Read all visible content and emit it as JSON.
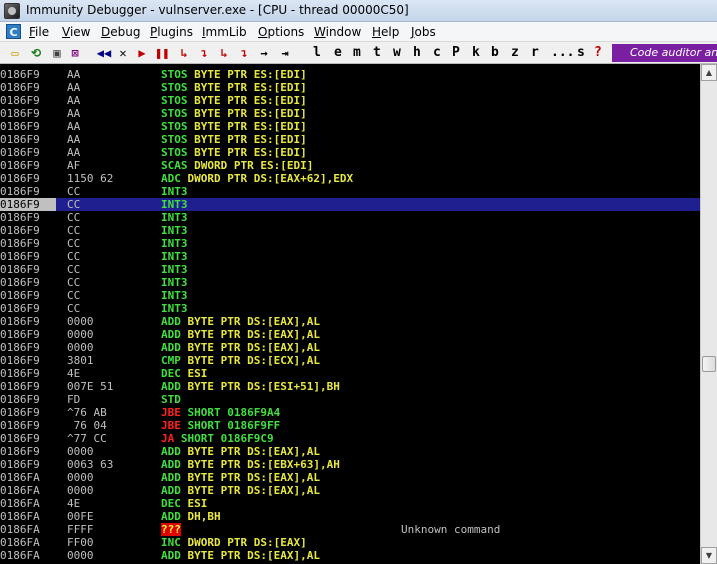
{
  "window": {
    "title": "Immunity Debugger - vulnserver.exe - [CPU - thread 00000C50]"
  },
  "menubar": {
    "cpu_icon": "C",
    "items": [
      {
        "accel": "F",
        "rest": "ile"
      },
      {
        "accel": "V",
        "rest": "iew"
      },
      {
        "accel": "D",
        "rest": "ebug"
      },
      {
        "accel": "P",
        "rest": "lugins"
      },
      {
        "accel": "I",
        "rest": "mmLib"
      },
      {
        "accel": "O",
        "rest": "ptions"
      },
      {
        "accel": "W",
        "rest": "indow"
      },
      {
        "accel": "H",
        "rest": "elp"
      },
      {
        "accel": "J",
        "rest": "obs"
      }
    ]
  },
  "toolbar": {
    "icons": [
      {
        "name": "open-icon",
        "glyph": "▭",
        "color": "#c8a000"
      },
      {
        "name": "restart-icon",
        "glyph": "⟲",
        "color": "#208020"
      },
      {
        "name": "close-file-icon",
        "glyph": "▣",
        "color": "#404040"
      },
      {
        "name": "debug-options-icon",
        "glyph": "⊠",
        "color": "#800080"
      },
      {
        "name": "rewind-icon",
        "glyph": "◀◀",
        "color": "#000080"
      },
      {
        "name": "stop-icon",
        "glyph": "✕",
        "color": "#000000"
      },
      {
        "name": "run-icon",
        "glyph": "▶",
        "color": "#c00000"
      },
      {
        "name": "pause-icon",
        "glyph": "❚❚",
        "color": "#c00000"
      },
      {
        "name": "step-into-icon",
        "glyph": "↳",
        "color": "#c00000"
      },
      {
        "name": "step-over-icon",
        "glyph": "↴",
        "color": "#c00000"
      },
      {
        "name": "trace-into-icon",
        "glyph": "↳",
        "color": "#c00000"
      },
      {
        "name": "trace-over-icon",
        "glyph": "↴",
        "color": "#c00000"
      },
      {
        "name": "execute-till-return-icon",
        "glyph": "→",
        "color": "#000000"
      },
      {
        "name": "go-to-icon",
        "glyph": "⇥",
        "color": "#000000"
      }
    ],
    "letters": [
      "l",
      "e",
      "m",
      "t",
      "w",
      "h",
      "c",
      "P",
      "k",
      "b",
      "z",
      "r",
      "...",
      "s",
      "?"
    ],
    "plugin_banner": "Code auditor and"
  },
  "disassembly": {
    "rows": [
      {
        "addr": "0186F9",
        "hex": "AA",
        "mnem": "STOS",
        "ops": "BYTE PTR ES:[EDI]",
        "kind": "normal"
      },
      {
        "addr": "0186F9",
        "hex": "AA",
        "mnem": "STOS",
        "ops": "BYTE PTR ES:[EDI]",
        "kind": "normal"
      },
      {
        "addr": "0186F9",
        "hex": "AA",
        "mnem": "STOS",
        "ops": "BYTE PTR ES:[EDI]",
        "kind": "normal"
      },
      {
        "addr": "0186F9",
        "hex": "AA",
        "mnem": "STOS",
        "ops": "BYTE PTR ES:[EDI]",
        "kind": "normal"
      },
      {
        "addr": "0186F9",
        "hex": "AA",
        "mnem": "STOS",
        "ops": "BYTE PTR ES:[EDI]",
        "kind": "normal"
      },
      {
        "addr": "0186F9",
        "hex": "AA",
        "mnem": "STOS",
        "ops": "BYTE PTR ES:[EDI]",
        "kind": "normal"
      },
      {
        "addr": "0186F9",
        "hex": "AA",
        "mnem": "STOS",
        "ops": "BYTE PTR ES:[EDI]",
        "kind": "normal"
      },
      {
        "addr": "0186F9",
        "hex": "AF",
        "mnem": "SCAS",
        "ops": "DWORD PTR ES:[EDI]",
        "kind": "normal"
      },
      {
        "addr": "0186F9",
        "hex": "1150 62",
        "mnem": "ADC",
        "ops": "DWORD PTR DS:[EAX+62],EDX",
        "kind": "normal"
      },
      {
        "addr": "0186F9",
        "hex": "CC",
        "mnem": "INT3",
        "ops": "",
        "kind": "normal"
      },
      {
        "addr": "0186F9",
        "hex": "CC",
        "mnem": "INT3",
        "ops": "",
        "kind": "normal",
        "selected": true
      },
      {
        "addr": "0186F9",
        "hex": "CC",
        "mnem": "INT3",
        "ops": "",
        "kind": "normal"
      },
      {
        "addr": "0186F9",
        "hex": "CC",
        "mnem": "INT3",
        "ops": "",
        "kind": "normal"
      },
      {
        "addr": "0186F9",
        "hex": "CC",
        "mnem": "INT3",
        "ops": "",
        "kind": "normal"
      },
      {
        "addr": "0186F9",
        "hex": "CC",
        "mnem": "INT3",
        "ops": "",
        "kind": "normal"
      },
      {
        "addr": "0186F9",
        "hex": "CC",
        "mnem": "INT3",
        "ops": "",
        "kind": "normal"
      },
      {
        "addr": "0186F9",
        "hex": "CC",
        "mnem": "INT3",
        "ops": "",
        "kind": "normal"
      },
      {
        "addr": "0186F9",
        "hex": "CC",
        "mnem": "INT3",
        "ops": "",
        "kind": "normal"
      },
      {
        "addr": "0186F9",
        "hex": "CC",
        "mnem": "INT3",
        "ops": "",
        "kind": "normal"
      },
      {
        "addr": "0186F9",
        "hex": "0000",
        "mnem": "ADD",
        "ops": "BYTE PTR DS:[EAX],AL",
        "kind": "normal"
      },
      {
        "addr": "0186F9",
        "hex": "0000",
        "mnem": "ADD",
        "ops": "BYTE PTR DS:[EAX],AL",
        "kind": "normal"
      },
      {
        "addr": "0186F9",
        "hex": "0000",
        "mnem": "ADD",
        "ops": "BYTE PTR DS:[EAX],AL",
        "kind": "normal"
      },
      {
        "addr": "0186F9",
        "hex": "3801",
        "mnem": "CMP",
        "ops": "BYTE PTR DS:[ECX],AL",
        "kind": "normal"
      },
      {
        "addr": "0186F9",
        "hex": "4E",
        "mnem": "DEC",
        "ops": "ESI",
        "kind": "normal"
      },
      {
        "addr": "0186F9",
        "hex": "007E 51",
        "mnem": "ADD",
        "ops": "BYTE PTR DS:[ESI+51],BH",
        "kind": "normal"
      },
      {
        "addr": "0186F9",
        "hex": "FD",
        "mnem": "STD",
        "ops": "",
        "kind": "normal"
      },
      {
        "addr": "0186F9",
        "hex": "^76 AB",
        "mnem": "JBE",
        "ops": "SHORT 0186F9A4",
        "kind": "jump"
      },
      {
        "addr": "0186F9",
        "hex": " 76 04",
        "mnem": "JBE",
        "ops": "SHORT 0186F9FF",
        "kind": "jump"
      },
      {
        "addr": "0186F9",
        "hex": "^77 CC",
        "mnem": "JA",
        "ops": "SHORT 0186F9C9",
        "kind": "jump"
      },
      {
        "addr": "0186F9",
        "hex": "0000",
        "mnem": "ADD",
        "ops": "BYTE PTR DS:[EAX],AL",
        "kind": "normal"
      },
      {
        "addr": "0186F9",
        "hex": "0063 63",
        "mnem": "ADD",
        "ops": "BYTE PTR DS:[EBX+63],AH",
        "kind": "normal"
      },
      {
        "addr": "0186FA",
        "hex": "0000",
        "mnem": "ADD",
        "ops": "BYTE PTR DS:[EAX],AL",
        "kind": "normal"
      },
      {
        "addr": "0186FA",
        "hex": "0000",
        "mnem": "ADD",
        "ops": "BYTE PTR DS:[EAX],AL",
        "kind": "normal"
      },
      {
        "addr": "0186FA",
        "hex": "4E",
        "mnem": "DEC",
        "ops": "ESI",
        "kind": "normal"
      },
      {
        "addr": "0186FA",
        "hex": "00FE",
        "mnem": "ADD",
        "ops": "DH,BH",
        "kind": "normal"
      },
      {
        "addr": "0186FA",
        "hex": "FFFF",
        "mnem": "???",
        "ops": "",
        "kind": "unknown",
        "comment": "Unknown command"
      },
      {
        "addr": "0186FA",
        "hex": "FF00",
        "mnem": "INC",
        "ops": "DWORD PTR DS:[EAX]",
        "kind": "normal"
      },
      {
        "addr": "0186FA",
        "hex": "0000",
        "mnem": "ADD",
        "ops": "BYTE PTR DS:[EAX],AL",
        "kind": "normal"
      }
    ]
  },
  "scrollbar": {
    "up_glyph": "▲",
    "down_glyph": "▼"
  }
}
